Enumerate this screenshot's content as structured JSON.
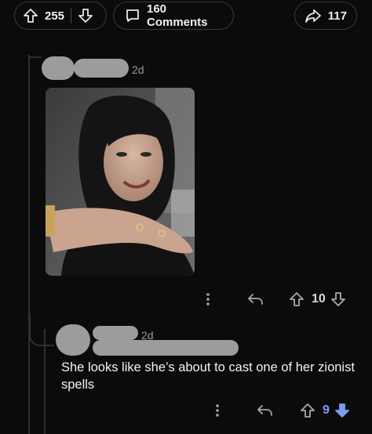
{
  "post_actions": {
    "upvote_count": "255",
    "comments_label": "160 Comments",
    "share_count": "117"
  },
  "parent_comment": {
    "age": "2d",
    "reply_vote_count": "10"
  },
  "reply_comment": {
    "age": "2d",
    "text": "She looks like she’s about to cast one of her zionist spells",
    "vote_count": "9"
  },
  "colors": {
    "background": "#0b0b0c",
    "downvote_active": "#7f9cf5",
    "redaction": "#9c9c9e"
  }
}
